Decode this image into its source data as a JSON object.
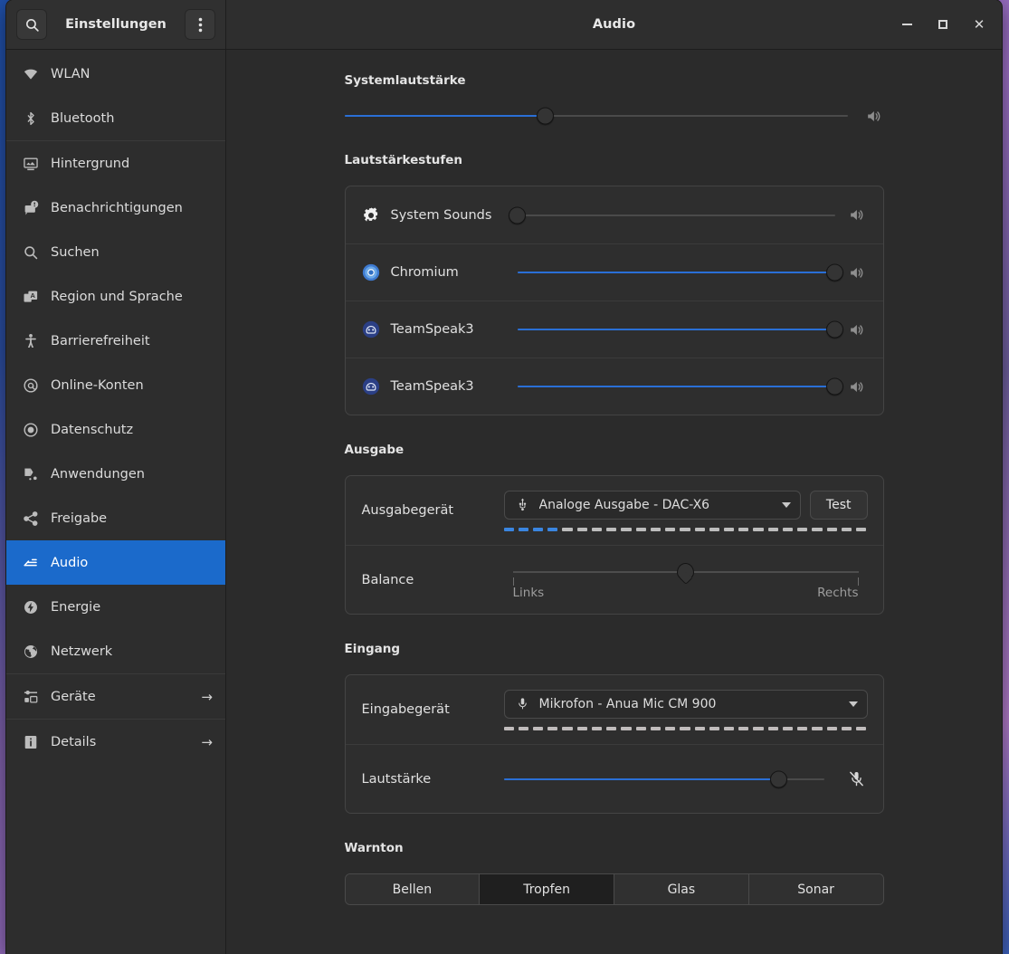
{
  "window": {
    "app_title": "Einstellungen",
    "page_title": "Audio",
    "search_icon": "search-icon",
    "menu_icon": "kebab-menu-icon",
    "minimize_label": "–",
    "maximize_label": "□",
    "close_label": "✕"
  },
  "sidebar": {
    "items": [
      {
        "label": "WLAN",
        "icon": "wifi-icon",
        "active": false,
        "arrow": false
      },
      {
        "label": "Bluetooth",
        "icon": "bluetooth-icon",
        "active": false,
        "arrow": false
      },
      {
        "label": "Hintergrund",
        "icon": "wallpaper-icon",
        "active": false,
        "arrow": false
      },
      {
        "label": "Benachrichtigungen",
        "icon": "notifications-icon",
        "active": false,
        "arrow": false
      },
      {
        "label": "Suchen",
        "icon": "search-icon",
        "active": false,
        "arrow": false
      },
      {
        "label": "Region und Sprache",
        "icon": "language-icon",
        "active": false,
        "arrow": false
      },
      {
        "label": "Barrierefreiheit",
        "icon": "accessibility-icon",
        "active": false,
        "arrow": false
      },
      {
        "label": "Online-Konten",
        "icon": "at-sign-icon",
        "active": false,
        "arrow": false
      },
      {
        "label": "Datenschutz",
        "icon": "privacy-icon",
        "active": false,
        "arrow": false
      },
      {
        "label": "Anwendungen",
        "icon": "applications-icon",
        "active": false,
        "arrow": false
      },
      {
        "label": "Freigabe",
        "icon": "share-icon",
        "active": false,
        "arrow": false
      },
      {
        "label": "Audio",
        "icon": "audio-icon",
        "active": true,
        "arrow": false
      },
      {
        "label": "Energie",
        "icon": "power-icon",
        "active": false,
        "arrow": false
      },
      {
        "label": "Netzwerk",
        "icon": "network-globe-icon",
        "active": false,
        "arrow": false
      },
      {
        "label": "Geräte",
        "icon": "devices-icon",
        "active": false,
        "arrow": true
      },
      {
        "label": "Details",
        "icon": "info-icon",
        "active": false,
        "arrow": true
      }
    ],
    "arrow_glyph": "→"
  },
  "main": {
    "system_volume": {
      "title": "Systemlautstärke",
      "value": 40,
      "speaker_icon": "volume-high-icon"
    },
    "volume_levels": {
      "title": "Lautstärkestufen",
      "streams": [
        {
          "name": "System Sounds",
          "icon": "gear-icon",
          "value": 0,
          "speaker_icon": "volume-high-icon"
        },
        {
          "name": "Chromium",
          "icon": "chromium-icon",
          "value": 100,
          "speaker_icon": "volume-high-icon"
        },
        {
          "name": "TeamSpeak3",
          "icon": "teamspeak-icon",
          "value": 100,
          "speaker_icon": "volume-high-icon"
        },
        {
          "name": "TeamSpeak3",
          "icon": "teamspeak-icon",
          "value": 100,
          "speaker_icon": "volume-high-icon"
        }
      ]
    },
    "output": {
      "title": "Ausgabe",
      "device_label": "Ausgabegerät",
      "device_value": "Analoge Ausgabe - DAC-X6",
      "device_icon": "usb-icon",
      "test_label": "Test",
      "meter_segments": 25,
      "meter_active": 4,
      "balance_label": "Balance",
      "balance_value": 50,
      "balance_left": "Links",
      "balance_right": "Rechts"
    },
    "input": {
      "title": "Eingang",
      "device_label": "Eingabegerät",
      "device_value": "Mikrofon - Anua Mic CM 900",
      "device_icon": "microphone-icon",
      "meter_segments": 25,
      "meter_active": 0,
      "volume_label": "Lautstärke",
      "volume_value": 86,
      "mic_icon": "microphone-muted-icon"
    },
    "alert_sound": {
      "title": "Warnton",
      "options": [
        "Bellen",
        "Tropfen",
        "Glas",
        "Sonar"
      ],
      "selected_index": 1
    }
  },
  "colors": {
    "accent": "#1b6acb",
    "slider_fill": "#2a6fd6",
    "meter_active": "#3a85e0",
    "window_bg": "#2b2b2b",
    "sidebar_bg": "#2d2d2d"
  }
}
